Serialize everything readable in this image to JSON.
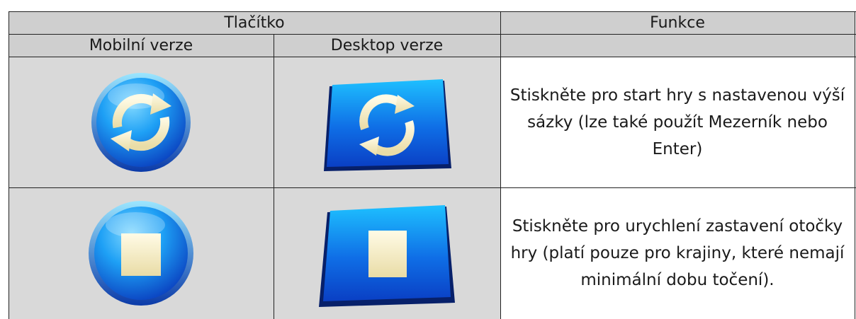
{
  "table": {
    "header": {
      "button_label": "Tlačítko",
      "function_label": "Funkce",
      "mobile_label": "Mobilní verze",
      "desktop_label": "Desktop verze",
      "empty_label": ""
    },
    "rows": [
      {
        "icon": "spin-icon",
        "description": "Stiskněte pro start hry s nastavenou výší sázky (lze také použít Mezerník nebo Enter)"
      },
      {
        "icon": "stop-icon",
        "description": "Stiskněte pro urychlení zastavení otočky hry (platí pouze pro krajiny, které nemají minimální dobu točení)."
      }
    ]
  },
  "colors": {
    "header_bg": "#cfcfcf",
    "icon_cell_bg": "#d9d9d9",
    "button_blue": "#1673e8",
    "button_glyph": "#f5efcf"
  }
}
